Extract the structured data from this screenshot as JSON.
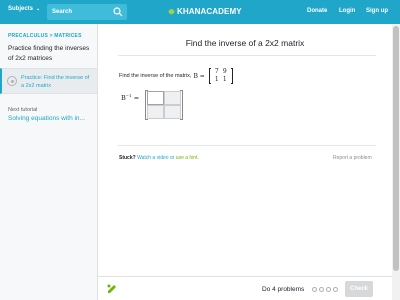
{
  "header": {
    "subjects_label": "Subjects",
    "search_label": "Search",
    "logo_text": "KHANACADEMY",
    "nav": [
      "Donate",
      "Login",
      "Sign up"
    ]
  },
  "sidebar": {
    "breadcrumb": "PRECALCULUS  > MATRICES",
    "title": "Practice finding the inverses of 2x2 matrices",
    "current_item": "Practice: Find the inverse of a 2x2 matrix",
    "next_label": "Next tutorial",
    "next_link": "Solving equations with in..."
  },
  "problem": {
    "title": "Find the inverse of a 2x2 matrix",
    "question_prefix": "Find the inverse of the matrix,",
    "matrix_name": "B =",
    "matrix_values": [
      "7",
      "9",
      "1",
      "1"
    ],
    "answer_label": "B",
    "answer_exponent": "−1",
    "answer_equals": "="
  },
  "help": {
    "stuck_label": "Stuck?",
    "video_link": "Watch a video",
    "or_text": "or",
    "hint_link": "use a hint.",
    "report_label": "Report a problem"
  },
  "footer": {
    "progress_label": "Do 4 problems",
    "dot_count": 4,
    "check_label": "Check"
  },
  "colors": {
    "brand": "#1fa6c9",
    "hint": "#71b307",
    "check_disabled": "#d6d8da"
  }
}
